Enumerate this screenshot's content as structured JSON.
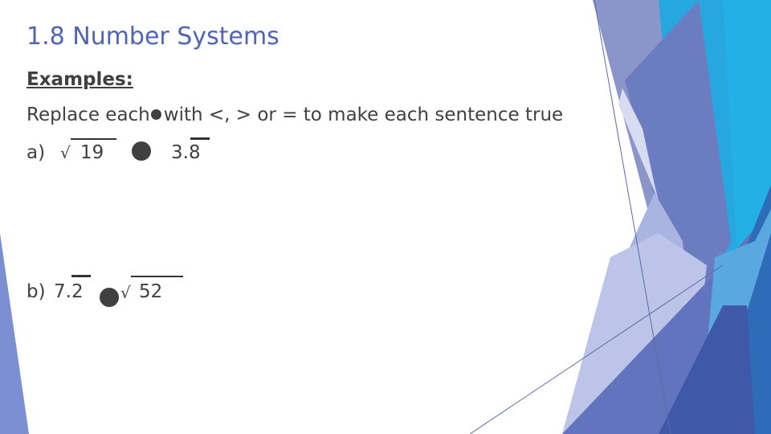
{
  "slide": {
    "title": "1.8 Number Systems",
    "subheading": "Examples:",
    "instruction_before": "Replace each",
    "instruction_after": "with <, > or = to make each sentence true",
    "examples": [
      {
        "label": "a)",
        "left": {
          "type": "square-root",
          "radicand": "19"
        },
        "right": {
          "type": "repeating-decimal",
          "whole": "3.",
          "repeating": "8"
        }
      },
      {
        "label": "b)",
        "left": {
          "type": "repeating-decimal",
          "whole": "7.",
          "repeating": "2"
        },
        "right": {
          "type": "square-root",
          "radicand": "52"
        }
      }
    ],
    "symbols": {
      "placeholder": "filled-circle",
      "radical": "√"
    }
  },
  "theme": {
    "title_color": "#4f64b5",
    "text_color": "#404040",
    "accent_colors": [
      "#8896c8",
      "#6c7cc0",
      "#22b0e6",
      "#2e6cb8",
      "#a9b4e0",
      "#5066b8",
      "#7c8fd2"
    ]
  }
}
